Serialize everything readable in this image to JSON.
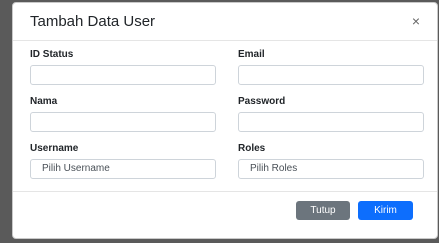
{
  "modal": {
    "title": "Tambah Data User",
    "close_glyph": "×",
    "close_icon": "close-icon"
  },
  "fields": {
    "id_status": {
      "label": "ID Status",
      "value": ""
    },
    "email": {
      "label": "Email",
      "value": ""
    },
    "nama": {
      "label": "Nama",
      "value": ""
    },
    "password": {
      "label": "Password",
      "value": ""
    },
    "username": {
      "label": "Username",
      "selected": "Pilih Username"
    },
    "roles": {
      "label": "Roles",
      "selected": "Pilih Roles"
    }
  },
  "footer": {
    "close_label": "Tutup",
    "submit_label": "Kirim"
  },
  "colors": {
    "primary": "#0d6efd",
    "secondary": "#6c757d",
    "backdrop": "#5a5a5a"
  }
}
